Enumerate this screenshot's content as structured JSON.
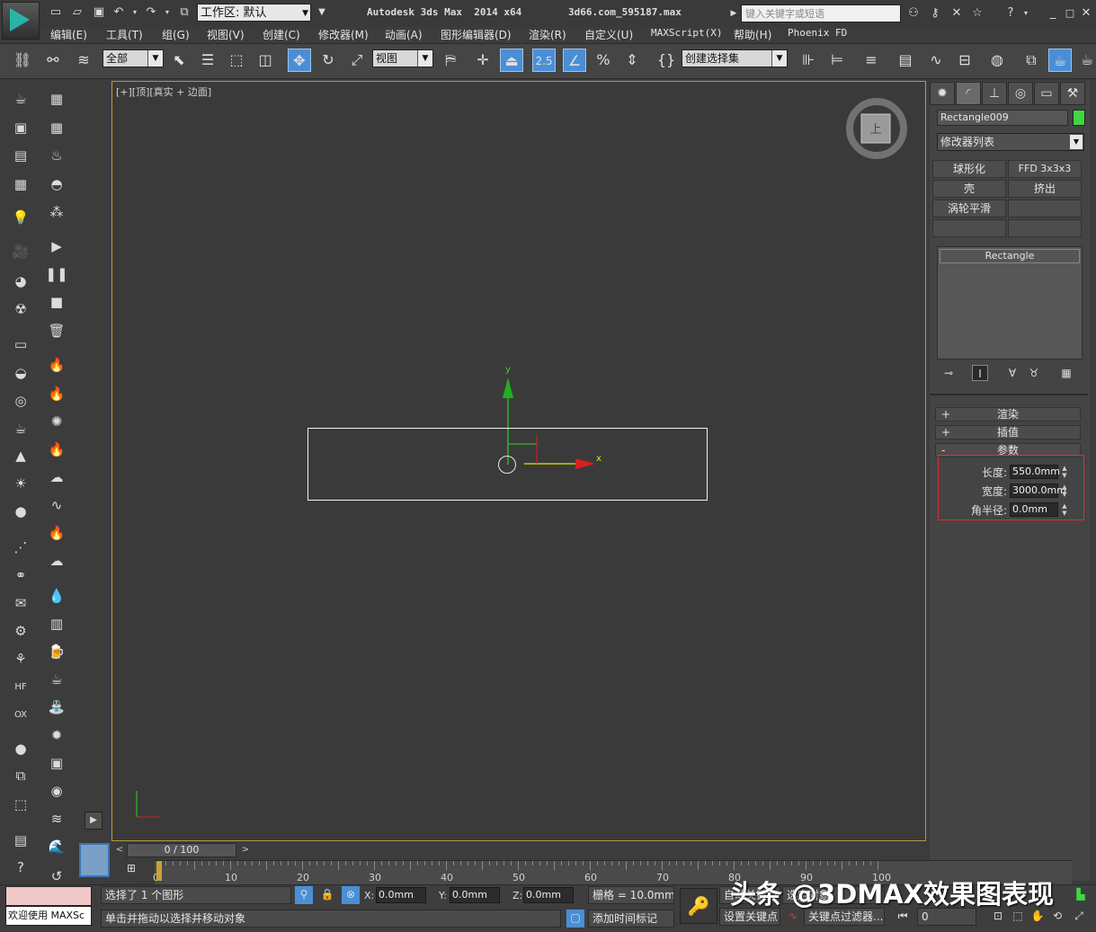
{
  "titlebar": {
    "workspace_label": "工作区: 默认",
    "app_title": "Autodesk 3ds Max  2014 x64",
    "file_title": "3d66.com_595187.max",
    "search_placeholder": "键入关键字或短语"
  },
  "menu": [
    "编辑(E)",
    "工具(T)",
    "组(G)",
    "视图(V)",
    "创建(C)",
    "修改器(M)",
    "动画(A)",
    "图形编辑器(D)",
    "渲染(R)",
    "自定义(U)",
    "MAXScript(X)",
    "帮助(H)",
    "Phoenix FD"
  ],
  "toolbar": {
    "selection_filter": "全部",
    "ref_coord": "视图",
    "snap_angle": "2.5",
    "selection_set": "创建选择集"
  },
  "viewport": {
    "label": "[+][顶][真实 + 边面]",
    "viewcube_face": "上",
    "axis_x": "x",
    "axis_y": "y"
  },
  "panel": {
    "object_name": "Rectangle009",
    "object_color": "#3fd63f",
    "modifier_list": "修改器列表",
    "modifier_buttons": [
      "球形化",
      "FFD 3x3x3",
      "壳",
      "挤出",
      "涡轮平滑",
      "",
      "",
      ""
    ],
    "stack_item": "Rectangle",
    "rollouts": [
      {
        "sign": "+",
        "label": "渲染"
      },
      {
        "sign": "+",
        "label": "插值"
      },
      {
        "sign": "-",
        "label": "参数"
      }
    ],
    "params": {
      "length_label": "长度:",
      "length_value": "550.0mm",
      "width_label": "宽度:",
      "width_value": "3000.0mm",
      "corner_label": "角半径:",
      "corner_value": "0.0mm"
    }
  },
  "timeline": {
    "slider_label": "0 / 100",
    "ticks": [
      "0",
      "10",
      "20",
      "30",
      "40",
      "50",
      "60",
      "70",
      "80",
      "90",
      "100"
    ]
  },
  "status": {
    "welcome": "欢迎使用 MAXSc",
    "selection_info": "选择了 1 个图形",
    "prompt": "单击并拖动以选择并移动对象",
    "x_label": "X:",
    "x_value": "0.0mm",
    "y_label": "Y:",
    "y_value": "0.0mm",
    "z_label": "Z:",
    "z_value": "0.0mm",
    "grid": "栅格 = 10.0mm",
    "add_time_tag": "添加时间标记",
    "auto_key": "自动关键点",
    "selected": "选定对象",
    "set_key": "设置关键点",
    "key_filters": "关键点过滤器...",
    "frame": "0"
  },
  "watermark": "头条 @3DMAX效果图表现"
}
